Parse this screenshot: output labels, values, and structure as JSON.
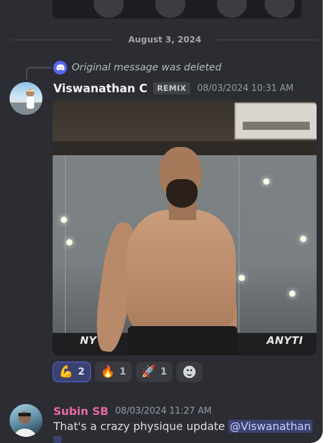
{
  "date_divider": "August 3, 2024",
  "reply": {
    "text": "Original message was deleted",
    "icon": "discord-icon"
  },
  "message1": {
    "author": "Viswanathan C",
    "tag": "REMIX",
    "timestamp": "08/03/2024 10:31 AM",
    "image": {
      "description_icon": "gym-photo",
      "visible_signage": [
        "NY",
        "ANYTI"
      ]
    },
    "reactions": [
      {
        "emoji": "💪",
        "name": "flexed-biceps",
        "count": "2",
        "active": true
      },
      {
        "emoji": "🔥",
        "name": "fire",
        "count": "1",
        "active": false
      },
      {
        "emoji": "🚀",
        "name": "rocket",
        "count": "1",
        "active": false
      }
    ]
  },
  "message2": {
    "author": "Subin SB",
    "timestamp": "08/03/2024 11:27 AM",
    "text": "That's a crazy physique update ",
    "mention": "@Viswanathan"
  },
  "colors": {
    "background": "#2c2d33",
    "mention_bg": "#3c4270",
    "blurple": "#5865f2",
    "author2": "#e86aa0"
  }
}
